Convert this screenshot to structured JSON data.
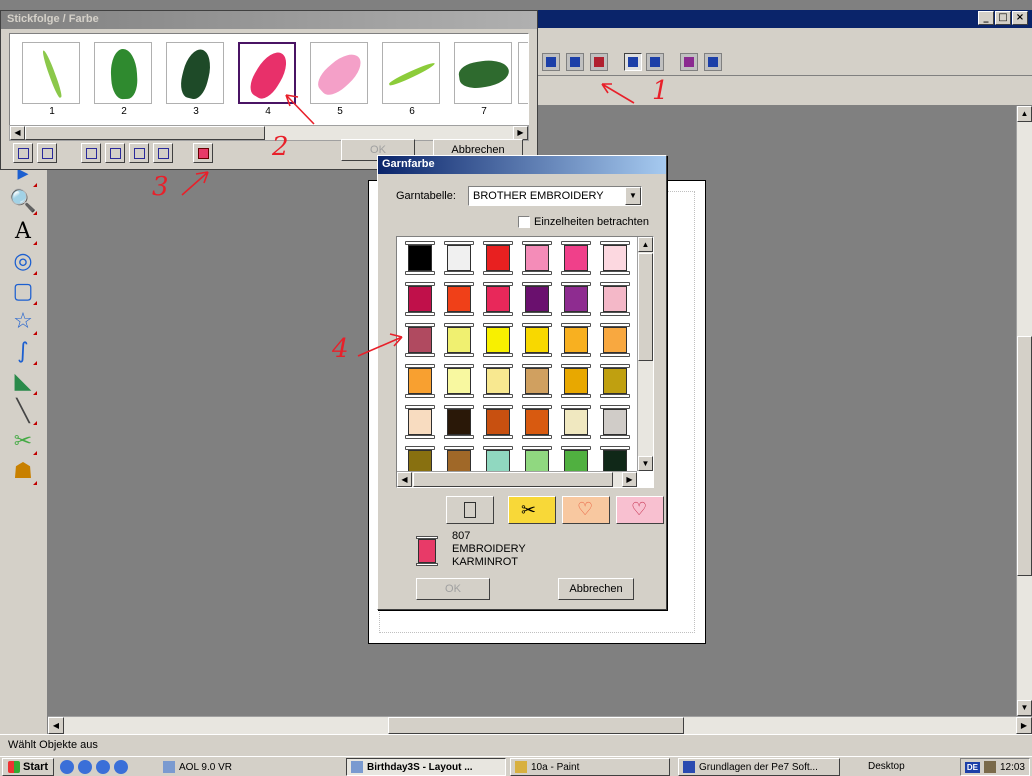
{
  "app": {
    "window_controls": [
      "_",
      "□",
      "×"
    ]
  },
  "stickfolge": {
    "title": "Stickfolge / Farbe",
    "thumbnails": [
      {
        "label": "1",
        "color": "#8bc84a"
      },
      {
        "label": "2",
        "color": "#2f8a2f"
      },
      {
        "label": "3",
        "color": "#1e4a28"
      },
      {
        "label": "4",
        "color": "#e8306a"
      },
      {
        "label": "5",
        "color": "#f4a0c8"
      },
      {
        "label": "6",
        "color": "#8ccc3a"
      },
      {
        "label": "7",
        "color": "#2e6a2e"
      }
    ],
    "ok_label": "OK",
    "cancel_label": "Abbrechen"
  },
  "garnfarbe": {
    "title": "Garnfarbe",
    "table_label": "Garntabelle:",
    "table_value": "BROTHER EMBROIDERY",
    "details_label": "Einzelheiten betrachten",
    "colors": [
      [
        "#000000",
        "#f0f0f0",
        "#e82020",
        "#f48cb8",
        "#f0408a",
        "#fcd8e0"
      ],
      [
        "#c0104a",
        "#f04018",
        "#e8285a",
        "#6a106e",
        "#8e2c90",
        "#f4b8c8"
      ],
      [
        "#b04a60",
        "#f0f070",
        "#f8f000",
        "#f8d800",
        "#f8b020",
        "#f8a840"
      ],
      [
        "#f8a030",
        "#f8f8a0",
        "#f8e890",
        "#d0a060",
        "#e8a800",
        "#c0a010"
      ],
      [
        "#f8dcc0",
        "#2a1808",
        "#c85010",
        "#d85a10",
        "#f0e8c0",
        "#d0ccc8"
      ],
      [
        "#887010",
        "#a06828",
        "#90d8c0",
        "#90d880",
        "#50b040",
        "#102818"
      ]
    ],
    "current": {
      "number": "807",
      "table": "EMBROIDERY",
      "name": "KARMINROT",
      "color": "#e83a68"
    },
    "ok_label": "OK",
    "cancel_label": "Abbrechen"
  },
  "annotations": [
    "1",
    "2",
    "3",
    "4"
  ],
  "status": {
    "text": "Wählt Objekte aus"
  },
  "taskbar": {
    "start": "Start",
    "tasks": [
      "AOL 9.0 VR",
      "Birthday3S - Layout ...",
      "10a - Paint",
      "Grundlagen der Pe7 Soft..."
    ],
    "desktop": "Desktop",
    "lang": "DE",
    "clock": "12:03"
  },
  "colors": {
    "annotation": "#e8202a",
    "selection": "#4a1464"
  }
}
